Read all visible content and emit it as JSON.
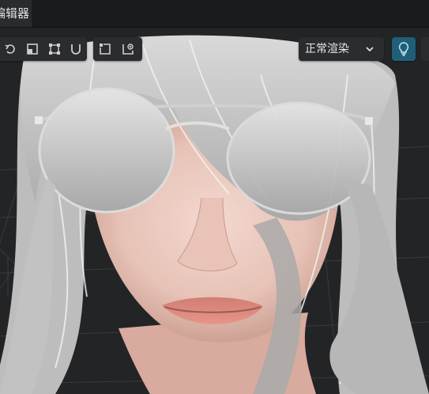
{
  "tab": {
    "label": "编辑器"
  },
  "toolbar": {
    "transform_tools": [
      "rotate-icon",
      "scale-icon",
      "bounds-icon",
      "magnet-icon"
    ],
    "camera_tools": [
      "frame-icon",
      "focus-add-icon"
    ]
  },
  "render_mode": {
    "label": "正常渲染",
    "icon": "chevron-down-icon"
  },
  "light_toggle": {
    "icon": "lightbulb-icon",
    "active": true,
    "accent": "#1f5f7a"
  },
  "viewport": {
    "background": "#232426",
    "grid_color": "#3a3b3e"
  }
}
